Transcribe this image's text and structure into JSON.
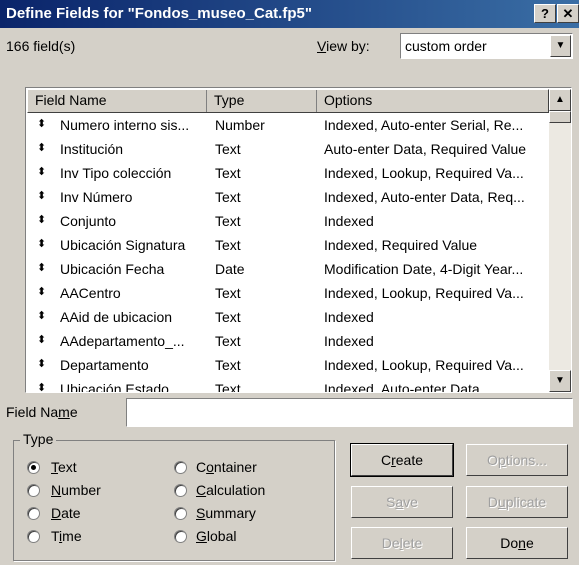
{
  "window": {
    "title": "Define Fields for \"Fondos_museo_Cat.fp5\"",
    "help_button": "?",
    "close_button": "✕"
  },
  "field_count": "166 field(s)",
  "view_by": {
    "label": "View by:",
    "value": "custom order"
  },
  "columns": {
    "name": "Field Name",
    "type": "Type",
    "options": "Options"
  },
  "fields": [
    {
      "name": "Numero interno sis...",
      "type": "Number",
      "options": "Indexed, Auto-enter Serial, Re..."
    },
    {
      "name": "Institución",
      "type": "Text",
      "options": "Auto-enter Data, Required Value"
    },
    {
      "name": "Inv Tipo colección",
      "type": "Text",
      "options": "Indexed, Lookup, Required Va..."
    },
    {
      "name": "Inv Número",
      "type": "Text",
      "options": "Indexed, Auto-enter Data, Req..."
    },
    {
      "name": "Conjunto",
      "type": "Text",
      "options": "Indexed"
    },
    {
      "name": "Ubicación Signatura",
      "type": "Text",
      "options": "Indexed, Required Value"
    },
    {
      "name": "Ubicación Fecha",
      "type": "Date",
      "options": "Modification Date, 4-Digit Year..."
    },
    {
      "name": "AACentro",
      "type": "Text",
      "options": "Indexed, Lookup, Required Va..."
    },
    {
      "name": "AAid de ubicacion",
      "type": "Text",
      "options": "Indexed"
    },
    {
      "name": "AAdepartamento_...",
      "type": "Text",
      "options": "Indexed"
    },
    {
      "name": "Departamento",
      "type": "Text",
      "options": "Indexed, Lookup, Required Va..."
    },
    {
      "name": "Ubicación Estado",
      "type": "Text",
      "options": "Indexed, Auto-enter Data"
    }
  ],
  "field_name": {
    "label": "Field Name",
    "value": ""
  },
  "type_group": {
    "label": "Type",
    "options": [
      "Text",
      "Number",
      "Date",
      "Time",
      "Container",
      "Calculation",
      "Summary",
      "Global"
    ],
    "selected": "Text"
  },
  "buttons": {
    "create": "Create",
    "options": "Options...",
    "save": "Save",
    "duplicate": "Duplicate",
    "delete": "Delete",
    "done": "Done"
  }
}
